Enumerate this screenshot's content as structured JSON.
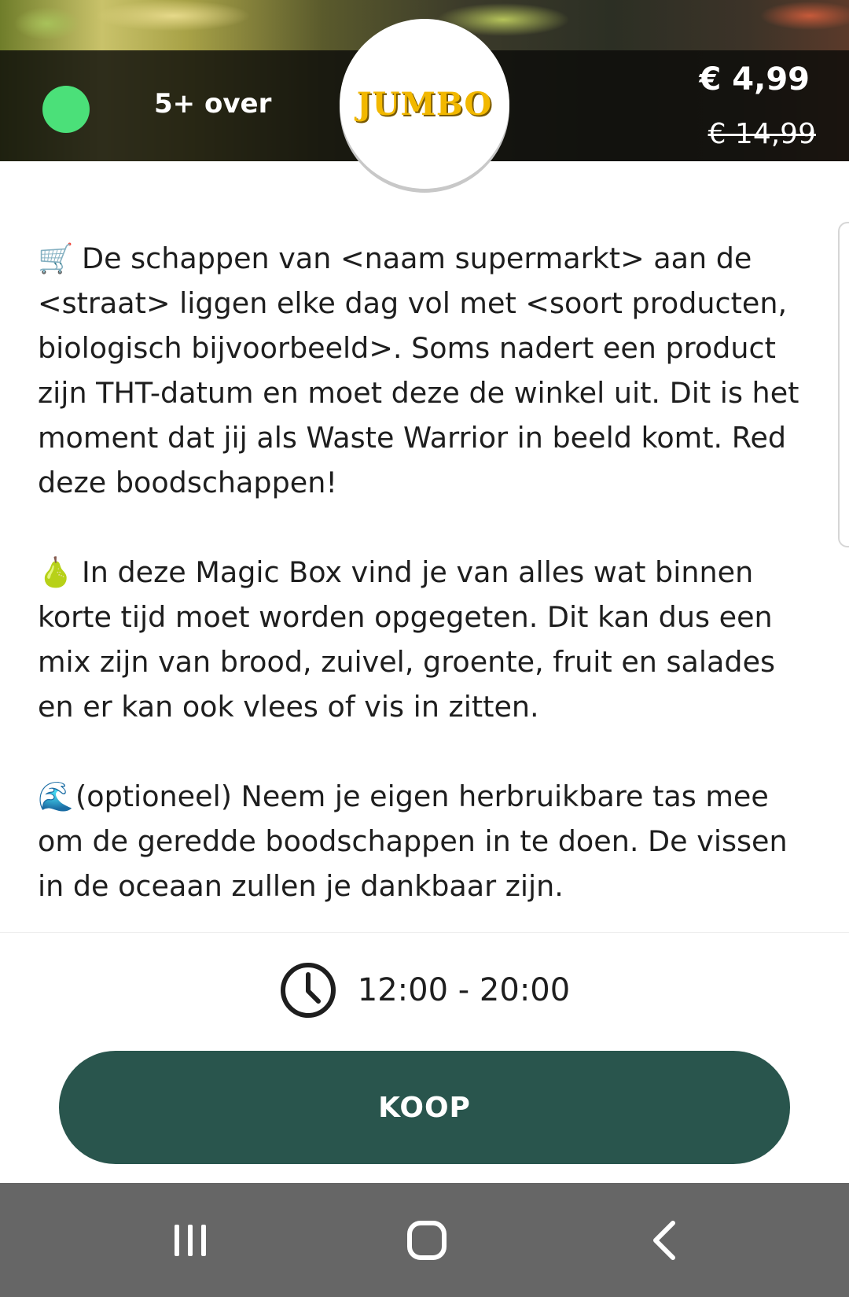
{
  "header": {
    "quantity_text": "5+ over",
    "store_logo_text": "JUMBO",
    "price_current": "€ 4,99",
    "price_original": "€ 14,99",
    "status_color": "#4be079"
  },
  "description": {
    "paragraphs": [
      {
        "icon": "shopping-cart-icon",
        "emoji": "🛒",
        "text": "De schappen van <naam supermarkt> aan de <straat> liggen elke dag vol met <soort producten, biologisch bijvoorbeeld>. Soms nadert een product zijn THT-datum en moet deze de winkel uit. Dit is het moment dat jij als Waste Warrior in beeld komt. Red deze boodschappen!"
      },
      {
        "icon": "pear-icon",
        "emoji": "🍐",
        "text": "In deze Magic Box vind je van alles wat binnen korte tijd moet worden opgegeten. Dit kan dus een mix zijn van brood, zuivel, groente, fruit en salades en er kan ook vlees of vis in zitten."
      },
      {
        "icon": "wave-icon",
        "emoji": "🌊",
        "text": "(optioneel) Neem je eigen herbruikbare tas mee om de geredde boodschappen in te doen. De vissen in de oceaan zullen je dankbaar zijn."
      }
    ]
  },
  "pickup": {
    "time_range": "12:00 - 20:00"
  },
  "actions": {
    "buy_label": "KOOP"
  },
  "colors": {
    "brand_dark_green": "#29554d",
    "jumbo_yellow": "#f2b800",
    "nav_bar_gray": "#666666"
  }
}
